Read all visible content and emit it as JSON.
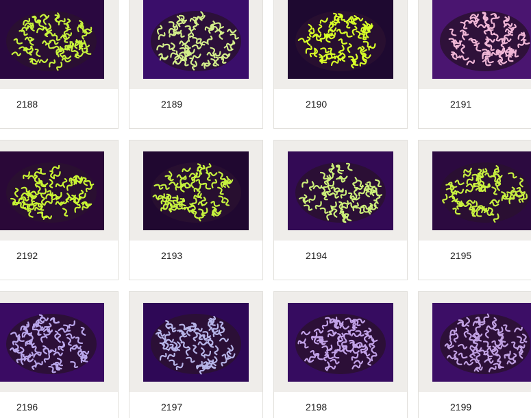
{
  "products": [
    {
      "id": "2188",
      "coral_color": "#c7f23c",
      "bg_color": "#2a0840"
    },
    {
      "id": "2189",
      "coral_color": "#d3ee8a",
      "bg_color": "#3a0e6a"
    },
    {
      "id": "2190",
      "coral_color": "#d8ff28",
      "bg_color": "#1e0930"
    },
    {
      "id": "2191",
      "coral_color": "#f0b6d6",
      "bg_color": "#4a1570"
    },
    {
      "id": "2192",
      "coral_color": "#c9f534",
      "bg_color": "#2a0838"
    },
    {
      "id": "2193",
      "coral_color": "#c6f23e",
      "bg_color": "#200830"
    },
    {
      "id": "2194",
      "coral_color": "#cdf07a",
      "bg_color": "#330a55"
    },
    {
      "id": "2195",
      "coral_color": "#c8f040",
      "bg_color": "#2c0a40"
    },
    {
      "id": "2196",
      "coral_color": "#b9a6ea",
      "bg_color": "#3a0b63"
    },
    {
      "id": "2197",
      "coral_color": "#b6b4e8",
      "bg_color": "#2e0856"
    },
    {
      "id": "2198",
      "coral_color": "#c2a2e8",
      "bg_color": "#360c60"
    },
    {
      "id": "2199",
      "coral_color": "#c0a0e2",
      "bg_color": "#3c0e66"
    }
  ]
}
